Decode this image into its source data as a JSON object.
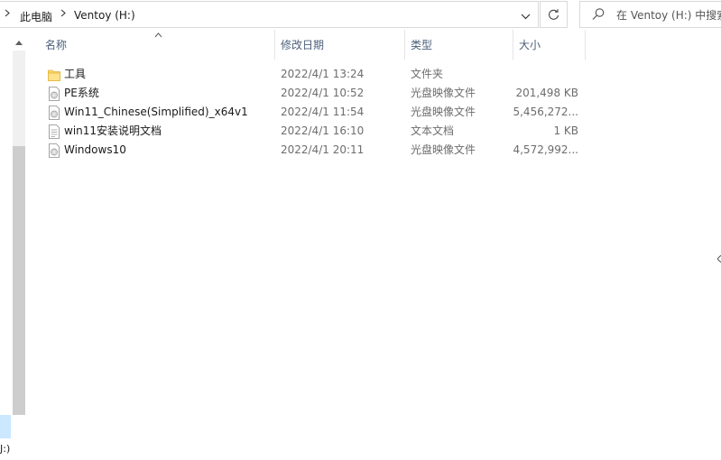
{
  "address_bar": {
    "breadcrumbs": [
      "此电脑",
      "Ventoy (H:)"
    ]
  },
  "search": {
    "placeholder": "在 Ventoy (H:) 中搜索"
  },
  "nav_pane": {
    "selected_drive_label": "J:)"
  },
  "columns": {
    "name": "名称",
    "date": "修改日期",
    "type": "类型",
    "size": "大小"
  },
  "files": [
    {
      "name": "工具",
      "date": "2022/4/1 13:24",
      "type": "文件夹",
      "size": "",
      "icon": "folder-icon"
    },
    {
      "name": "PE系统",
      "date": "2022/4/1 10:52",
      "type": "光盘映像文件",
      "size": "201,498 KB",
      "icon": "disc-image-icon"
    },
    {
      "name": "Win11_Chinese(Simplified)_x64v1",
      "date": "2022/4/1 11:54",
      "type": "光盘映像文件",
      "size": "5,456,272...",
      "icon": "disc-image-icon"
    },
    {
      "name": "win11安装说明文档",
      "date": "2022/4/1 16:10",
      "type": "文本文档",
      "size": "1 KB",
      "icon": "text-document-icon"
    },
    {
      "name": "Windows10",
      "date": "2022/4/1 20:11",
      "type": "光盘映像文件",
      "size": "4,572,992...",
      "icon": "disc-image-icon"
    }
  ],
  "colors": {
    "header_text": "#4c607a",
    "secondary_text": "#6d6d6d",
    "folder": "#ffd766",
    "selection": "#cce8ff"
  }
}
